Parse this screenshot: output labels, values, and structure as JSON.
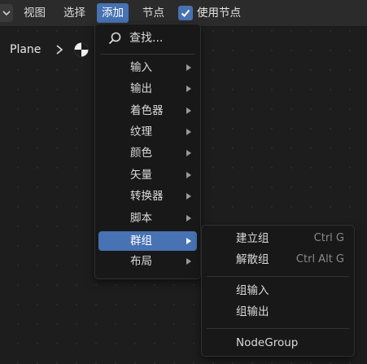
{
  "header": {
    "menus": [
      "视图",
      "选择",
      "添加",
      "节点"
    ],
    "active_menu": "添加",
    "use_nodes": {
      "checked": true,
      "label": "使用节点"
    }
  },
  "breadcrumb": {
    "object": "Plane",
    "icons": [
      "chevron-right-icon",
      "material-ball-icon"
    ]
  },
  "add_menu": {
    "search_label": "查找...",
    "items": [
      {
        "label": "输入"
      },
      {
        "label": "输出"
      },
      {
        "label": "着色器"
      },
      {
        "label": "纹理"
      },
      {
        "label": "颜色"
      },
      {
        "label": "矢量"
      },
      {
        "label": "转换器"
      },
      {
        "label": "脚本"
      },
      {
        "label": "群组",
        "highlighted": true
      },
      {
        "label": "布局"
      }
    ]
  },
  "group_submenu": {
    "items": [
      {
        "label": "建立组",
        "shortcut": "Ctrl G"
      },
      {
        "label": "解散组",
        "shortcut": "Ctrl Alt G"
      },
      {
        "label": "组输入",
        "shortcut": ""
      },
      {
        "label": "组输出",
        "shortcut": ""
      },
      {
        "label": "NodeGroup",
        "shortcut": ""
      }
    ]
  },
  "colors": {
    "accent": "#4772b3",
    "menu_bg": "#181818",
    "canvas_bg": "#1d1d1d"
  }
}
